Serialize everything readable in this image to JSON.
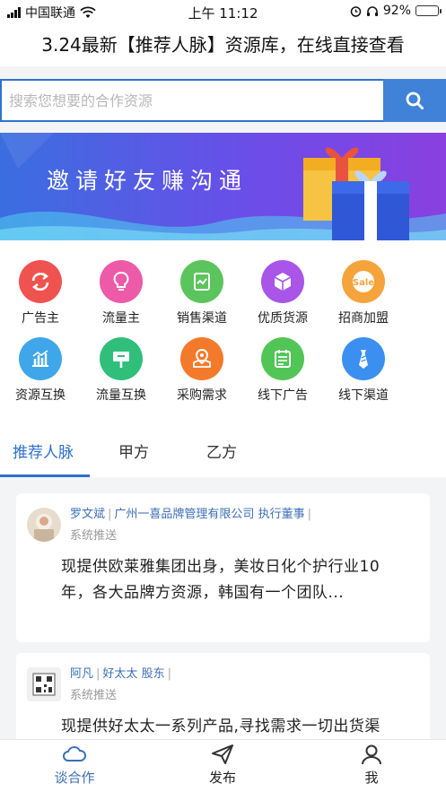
{
  "status_bar": {
    "carrier": "中国联通",
    "time": "上午 11:12",
    "battery_percent": "92%",
    "battery_level": 0.92,
    "icons": [
      "signal-icon",
      "wifi-icon",
      "alarm-icon",
      "headphones-icon",
      "battery-icon"
    ]
  },
  "header": {
    "title": "3.24最新【推荐人脉】资源库，在线直接查看"
  },
  "search": {
    "placeholder": "搜索您想要的合作资源",
    "value": "",
    "button_icon": "search-icon"
  },
  "banner": {
    "text": "邀请好友赚沟通"
  },
  "categories": [
    {
      "label": "广告主",
      "icon": "refresh-icon",
      "color": "#ef5350"
    },
    {
      "label": "流量主",
      "icon": "lightbulb-icon",
      "color": "#ec5aa8"
    },
    {
      "label": "销售渠道",
      "icon": "chart-icon",
      "color": "#5cc45d"
    },
    {
      "label": "优质货源",
      "icon": "box-icon",
      "color": "#a855e8"
    },
    {
      "label": "招商加盟",
      "icon": "sale-icon",
      "color": "#f5a33b",
      "icon_text": "Sale"
    },
    {
      "label": "资源互换",
      "icon": "bar-chart-icon",
      "color": "#3fa6ea"
    },
    {
      "label": "流量互换",
      "icon": "billboard-icon",
      "color": "#2fbf7a"
    },
    {
      "label": "采购需求",
      "icon": "map-pin-icon",
      "color": "#f37a2a"
    },
    {
      "label": "线下广告",
      "icon": "calendar-icon",
      "color": "#52c557"
    },
    {
      "label": "线下渠道",
      "icon": "tie-icon",
      "color": "#3b8ff0"
    }
  ],
  "tabs": [
    {
      "label": "推荐人脉",
      "active": true
    },
    {
      "label": "甲方",
      "active": false
    },
    {
      "label": "乙方",
      "active": false
    }
  ],
  "feed": [
    {
      "name": "罗文斌",
      "company": "广州一喜品牌管理有限公司",
      "role": "执行董事",
      "source": "系统推送",
      "body": "现提供欧莱雅集团出身，美妆日化个护行业10年，各大品牌方资源，韩国有一个团队..."
    },
    {
      "name": "阿凡",
      "company": "好太太",
      "role": "股东",
      "source": "系统推送",
      "body": "现提供好太太一系列产品,寻找需求一切出货渠"
    }
  ],
  "bottom_nav": [
    {
      "label": "谈合作",
      "icon": "cloud-icon",
      "active": true
    },
    {
      "label": "发布",
      "icon": "send-icon",
      "active": false
    },
    {
      "label": "我",
      "icon": "user-icon",
      "active": false
    }
  ],
  "colors": {
    "accent": "#2f6fce",
    "search_button": "#3f82d8",
    "link_text": "#3b6eb5"
  }
}
